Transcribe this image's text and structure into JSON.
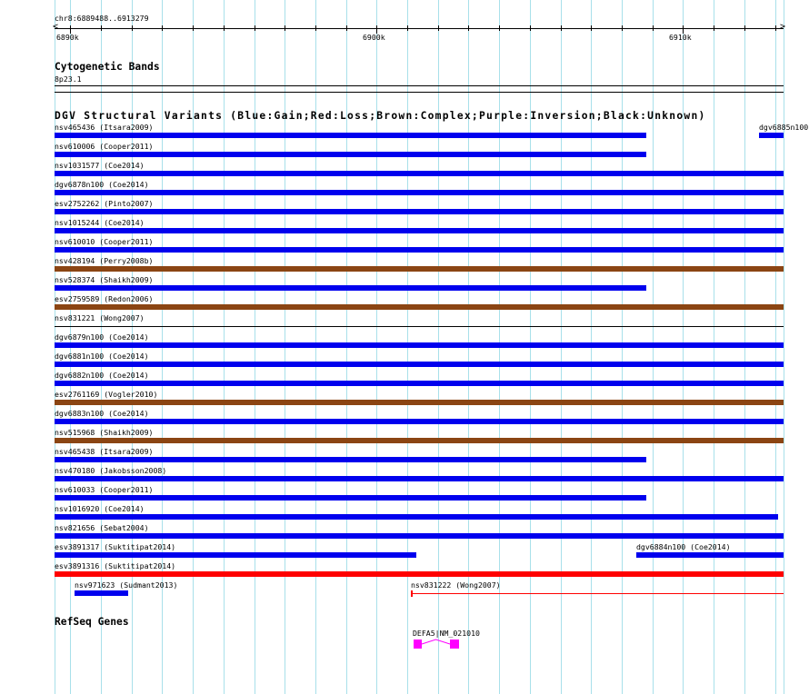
{
  "region": {
    "chrom": "chr8",
    "start": 6889488,
    "end": 6913279,
    "label": "chr8:6889488..6913279"
  },
  "ruler": {
    "major_labels": [
      {
        "pos": 6890000,
        "label": "6890k"
      },
      {
        "pos": 6900000,
        "label": "6900k"
      },
      {
        "pos": 6910000,
        "label": "6910k"
      }
    ]
  },
  "cytoband": {
    "title": "Cytogenetic Bands",
    "band": "8p23.1"
  },
  "dgv": {
    "title": "DGV Structural Variants (Blue:Gain;Red:Loss;Brown:Complex;Purple:Inversion;Black:Unknown)",
    "colors": {
      "gain": "#0000ee",
      "loss": "#ff0000",
      "complex": "#8b4513",
      "unknown": "#000000"
    },
    "rows": [
      [
        {
          "label": "nsv465436 (Itsara2009)",
          "type": "gain",
          "start": 6889488,
          "end": 6908800
        },
        {
          "label": "dgv6885n100 (Coe2014)",
          "type": "gain",
          "start": 6912480,
          "end": 6913279
        }
      ],
      [
        {
          "label": "nsv610006 (Cooper2011)",
          "type": "gain",
          "start": 6889488,
          "end": 6908800
        }
      ],
      [
        {
          "label": "nsv1031577 (Coe2014)",
          "type": "gain",
          "start": 6889488,
          "end": 6913279
        }
      ],
      [
        {
          "label": "dgv6878n100 (Coe2014)",
          "type": "gain",
          "start": 6889488,
          "end": 6913279
        }
      ],
      [
        {
          "label": "esv2752262 (Pinto2007)",
          "type": "gain",
          "start": 6889488,
          "end": 6913279
        }
      ],
      [
        {
          "label": "nsv1015244 (Coe2014)",
          "type": "gain",
          "start": 6889488,
          "end": 6913279
        }
      ],
      [
        {
          "label": "nsv610010 (Cooper2011)",
          "type": "gain",
          "start": 6889488,
          "end": 6913279
        }
      ],
      [
        {
          "label": "nsv428194 (Perry2008b)",
          "type": "complex",
          "start": 6889488,
          "end": 6913279
        }
      ],
      [
        {
          "label": "nsv528374 (Shaikh2009)",
          "type": "gain",
          "start": 6889488,
          "end": 6908800
        }
      ],
      [
        {
          "label": "esv2759589 (Redon2006)",
          "type": "complex",
          "start": 6889488,
          "end": 6913279
        }
      ],
      [
        {
          "label": "nsv831221 (Wong2007)",
          "type": "unknown",
          "start": 6889488,
          "end": 6913279,
          "thin": true
        }
      ],
      [
        {
          "label": "dgv6879n100 (Coe2014)",
          "type": "gain",
          "start": 6889488,
          "end": 6913279
        }
      ],
      [
        {
          "label": "dgv6881n100 (Coe2014)",
          "type": "gain",
          "start": 6889488,
          "end": 6913279
        }
      ],
      [
        {
          "label": "dgv6882n100 (Coe2014)",
          "type": "gain",
          "start": 6889488,
          "end": 6913279
        }
      ],
      [
        {
          "label": "esv2761169 (Vogler2010)",
          "type": "complex",
          "start": 6889488,
          "end": 6913279
        }
      ],
      [
        {
          "label": "dgv6883n100 (Coe2014)",
          "type": "gain",
          "start": 6889488,
          "end": 6913279
        }
      ],
      [
        {
          "label": "nsv515968 (Shaikh2009)",
          "type": "complex",
          "start": 6889488,
          "end": 6913279
        }
      ],
      [
        {
          "label": "nsv465438 (Itsara2009)",
          "type": "gain",
          "start": 6889488,
          "end": 6908800
        }
      ],
      [
        {
          "label": "nsv470180 (Jakobsson2008)",
          "type": "gain",
          "start": 6889488,
          "end": 6913279
        }
      ],
      [
        {
          "label": "nsv610033 (Cooper2011)",
          "type": "gain",
          "start": 6889488,
          "end": 6908800
        }
      ],
      [
        {
          "label": "nsv1016920 (Coe2014)",
          "type": "gain",
          "start": 6889488,
          "end": 6913100
        }
      ],
      [
        {
          "label": "nsv821656 (Sebat2004)",
          "type": "gain",
          "start": 6889488,
          "end": 6913279
        }
      ],
      [
        {
          "label": "esv3891317 (Suktitipat2014)",
          "type": "gain",
          "start": 6889488,
          "end": 6901300
        },
        {
          "label": "dgv6884n100 (Coe2014)",
          "type": "gain",
          "start": 6908480,
          "end": 6913279
        }
      ],
      [
        {
          "label": "esv3891316 (Suktitipat2014)",
          "type": "loss",
          "start": 6889488,
          "end": 6913279
        }
      ],
      [
        {
          "label": "nsv971623 (Sudmant2013)",
          "type": "gain",
          "start": 6890140,
          "end": 6891890
        },
        {
          "label": "nsv831222 (Wong2007)",
          "type": "loss",
          "start": 6901120,
          "end": 6913279,
          "thin": true
        }
      ]
    ]
  },
  "refseq": {
    "title": "RefSeq Genes",
    "genes": [
      {
        "label": "DEFA5|NM_021010",
        "color": "#ff00ff",
        "exons": [
          [
            6901200,
            6901480
          ],
          [
            6902400,
            6902700
          ]
        ]
      }
    ]
  }
}
